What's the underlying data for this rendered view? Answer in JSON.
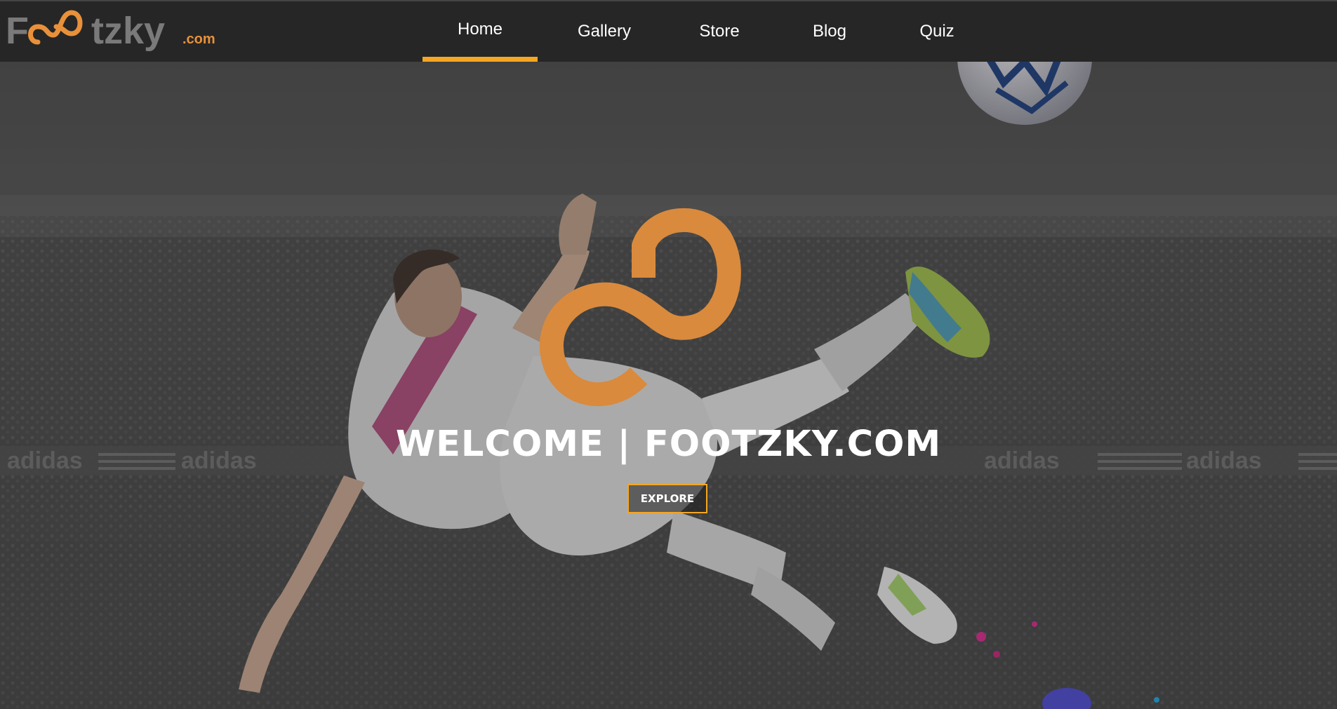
{
  "brand": {
    "logo_text": "Footzky",
    "logo_suffix": ".com",
    "colors": {
      "accent": "#f5a623",
      "orange": "#e8913a",
      "gray": "#7a7a7a",
      "navbar": "#262626"
    }
  },
  "nav": {
    "items": [
      {
        "label": "Home",
        "active": true
      },
      {
        "label": "Gallery",
        "active": false
      },
      {
        "label": "Store",
        "active": false
      },
      {
        "label": "Blog",
        "active": false
      },
      {
        "label": "Quiz",
        "active": false
      }
    ]
  },
  "hero": {
    "title": "WELCOME | FOOTZKY.COM",
    "cta_label": "EXPLORE",
    "emblem_icon": "infinity-logo-icon",
    "banner_text": "adidas"
  }
}
